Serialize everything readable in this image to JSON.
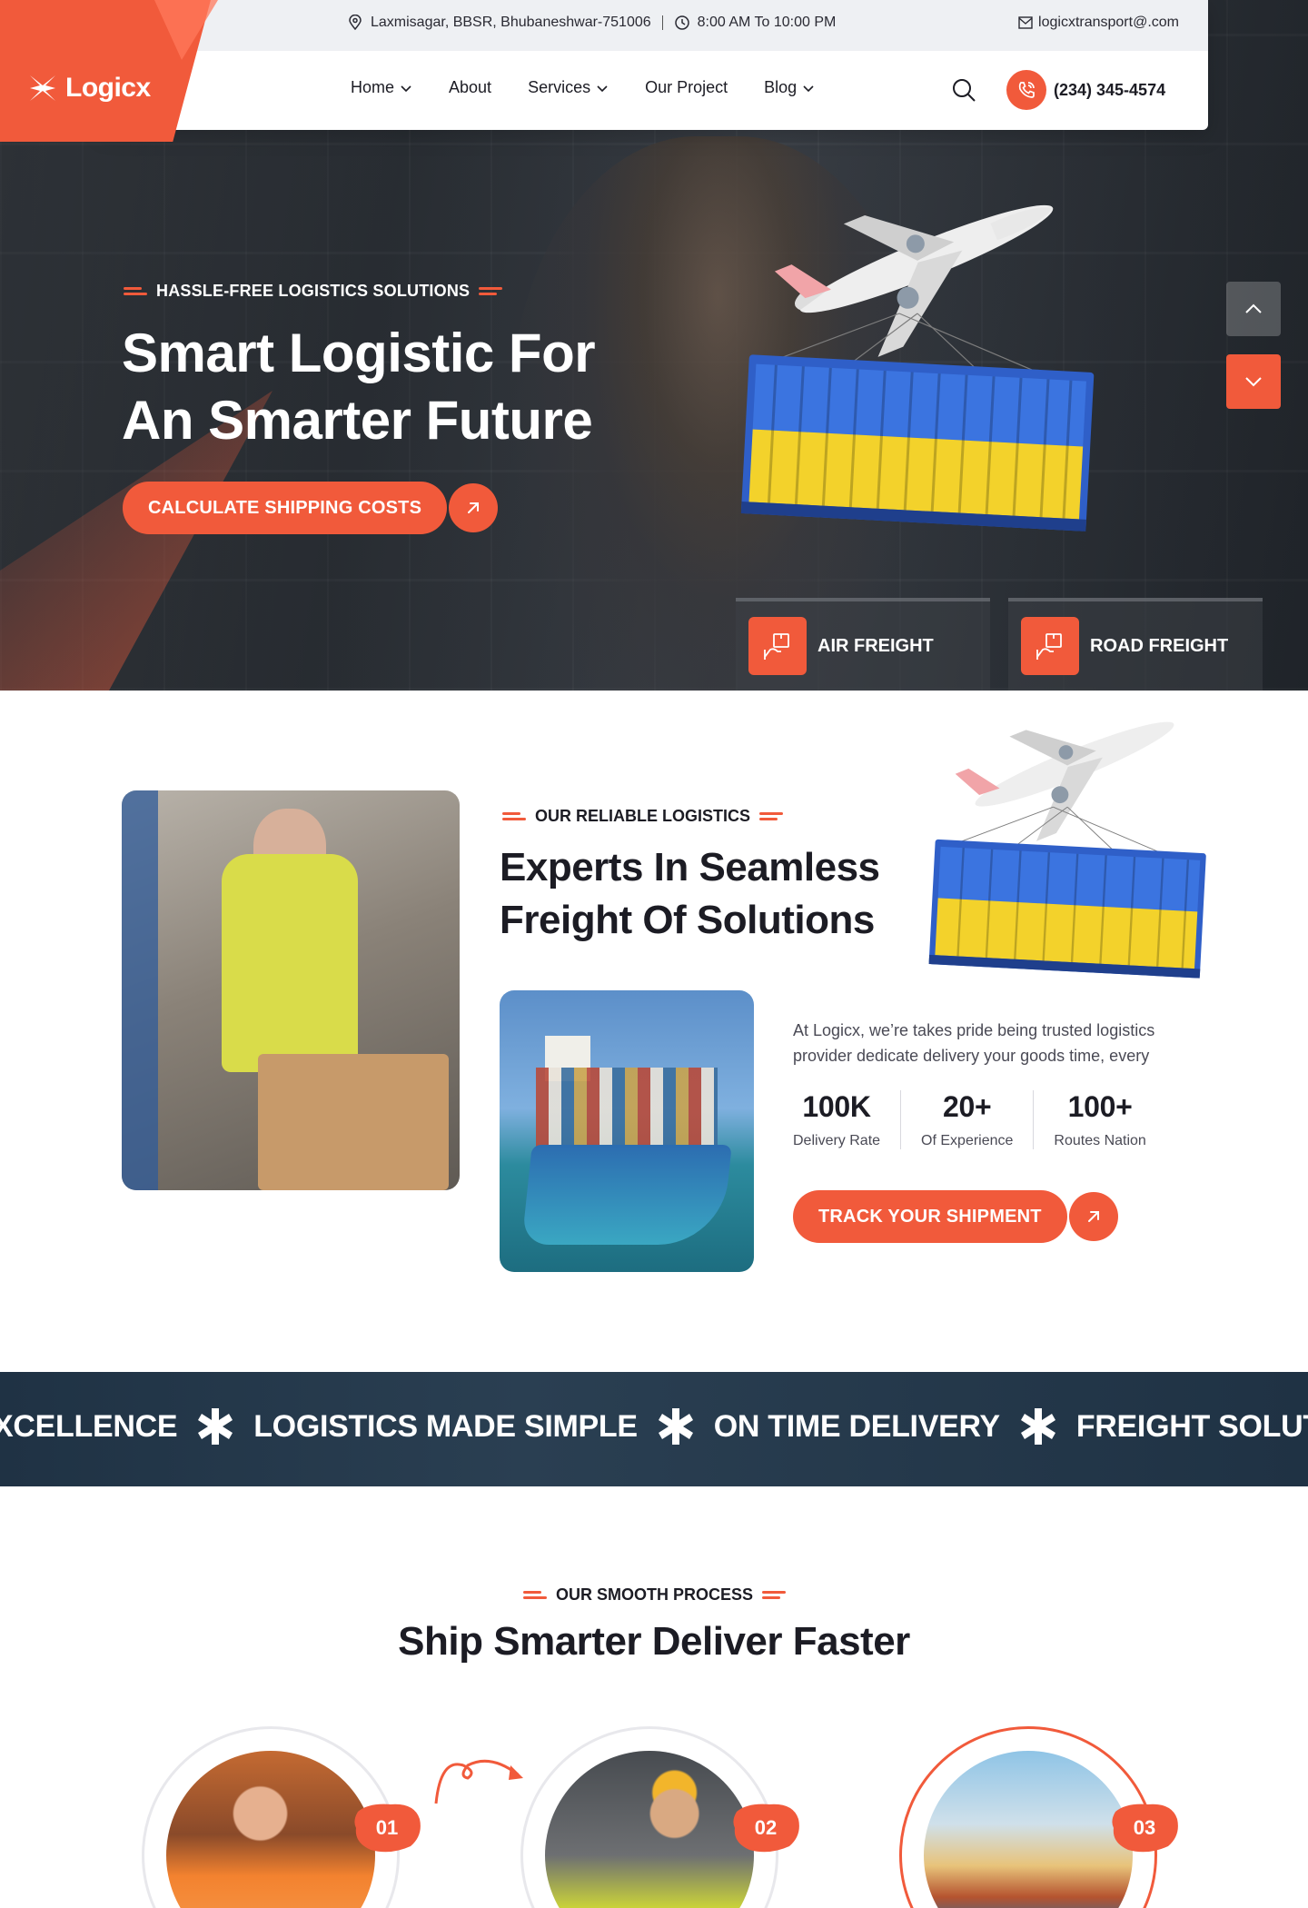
{
  "header": {
    "address": "Laxmisagar, BBSR, Bhubaneshwar-751006",
    "hours": "8:00 AM To 10:00 PM",
    "email": "logicxtransport@.com",
    "logo_text": "Logicx",
    "nav": [
      {
        "label": "Home",
        "has_dropdown": true
      },
      {
        "label": "About",
        "has_dropdown": false
      },
      {
        "label": "Services",
        "has_dropdown": true
      },
      {
        "label": "Our Project",
        "has_dropdown": false
      },
      {
        "label": "Blog",
        "has_dropdown": true
      }
    ],
    "phone": "(234) 345-4574"
  },
  "hero": {
    "tagline": "HASSLE-FREE LOGISTICS SOLUTIONS",
    "title_line1": "Smart Logistic For",
    "title_line2": "An Smarter Future",
    "cta_label": "CALCULATE SHIPPING COSTS",
    "freight_tabs": [
      "AIR FREIGHT",
      "ROAD FREIGHT"
    ]
  },
  "about": {
    "tagline": "OUR RELIABLE LOGISTICS",
    "title_line1": "Experts In Seamless",
    "title_line2": "Freight Of Solutions",
    "description_line1": "At Logicx, we’re takes pride being trusted logistics",
    "description_line2": "provider dedicate delivery your goods time, every",
    "stats": [
      {
        "value": "100K",
        "label": "Delivery Rate"
      },
      {
        "value": "20+",
        "label": "Of Experience"
      },
      {
        "value": "100+",
        "label": "Routes Nation"
      }
    ],
    "cta_label": "TRACK YOUR SHIPMENT"
  },
  "marquee": {
    "items": [
      "XCELLENCE",
      "LOGISTICS MADE SIMPLE",
      "ON TIME DELIVERY",
      "FREIGHT SOLUTIONS"
    ]
  },
  "process": {
    "tagline": "OUR SMOOTH PROCESS",
    "title": "Ship Smarter Deliver Faster",
    "steps": [
      "01",
      "02",
      "03"
    ]
  },
  "colors": {
    "accent": "#f15a3b",
    "dark_navy": "#1f3244",
    "text_dark": "#1c1c24"
  },
  "icons": [
    "location-pin-icon",
    "clock-icon",
    "mail-icon",
    "search-icon",
    "phone-icon",
    "arrow-up-right-icon",
    "chevron-up-icon",
    "chevron-down-icon",
    "cargo-handling-icon",
    "asterisk-star-icon"
  ]
}
